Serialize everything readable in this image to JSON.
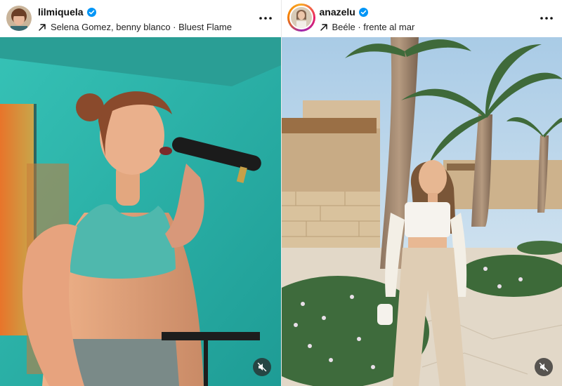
{
  "posts": [
    {
      "username": "lilmiquela",
      "verified": true,
      "audio": "Selena Gomez, benny blanco · Bluest Flame",
      "avatar_icon": "avatar-photo",
      "media_colors": {
        "wall": "#2fb3a8",
        "accent": "#e87a2a"
      }
    },
    {
      "username": "anazelu",
      "verified": true,
      "audio": "Beéle · frente al mar",
      "avatar_icon": "avatar-photo-story-ring",
      "media_colors": {
        "sky": "#b9d6ea",
        "stone": "#d9c8a8"
      }
    }
  ],
  "icons": {
    "verified": "verified-badge-icon",
    "audio": "audio-arrow-icon",
    "more": "more-options-icon",
    "mute": "muted-speaker-icon"
  },
  "colors": {
    "verified_blue": "#0095f6"
  }
}
